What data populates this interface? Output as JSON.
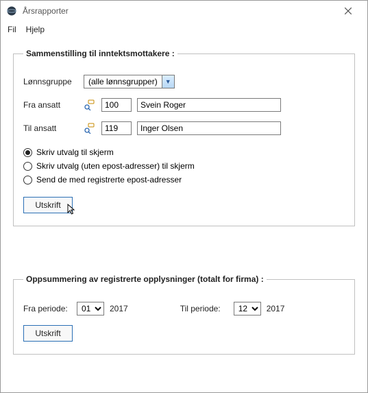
{
  "window": {
    "title": "Årsrapporter"
  },
  "menu": {
    "fil": "Fil",
    "hjelp": "Hjelp"
  },
  "group1": {
    "legend": "Sammenstilling til inntektsmottakere :",
    "lonnsgruppe_label": "Lønnsgruppe",
    "lonnsgruppe_value": "(alle lønnsgrupper)",
    "fra_ansatt_label": "Fra ansatt",
    "fra_ansatt_id": "100",
    "fra_ansatt_name": "Svein Roger",
    "til_ansatt_label": "Til ansatt",
    "til_ansatt_id": "119",
    "til_ansatt_name": "Inger Olsen",
    "radio1": "Skriv utvalg til skjerm",
    "radio2": "Skriv utvalg (uten epost-adresser) til skjerm",
    "radio3": "Send de med registrerte epost-adresser",
    "utskrift_btn": "Utskrift"
  },
  "group2": {
    "legend": "Oppsummering av registrerte opplysninger (totalt for firma) :",
    "fra_periode_label": "Fra periode:",
    "fra_periode_value": "01",
    "fra_periode_year": "2017",
    "til_periode_label": "Til periode:",
    "til_periode_value": "12",
    "til_periode_year": "2017",
    "utskrift_btn": "Utskrift"
  }
}
